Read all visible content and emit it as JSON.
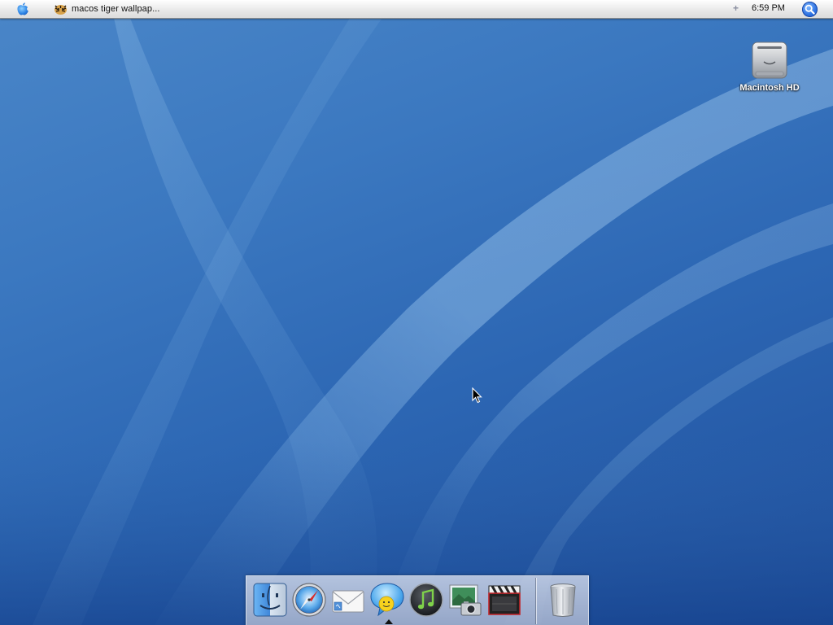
{
  "menubar": {
    "apple_icon": "apple-icon",
    "window_title": "macos tiger wallpap...",
    "app_icon": "tiger-icon",
    "menu_extra": "+",
    "clock": "6:59 PM",
    "spotlight_icon": "spotlight-search-icon"
  },
  "desktop": {
    "icons": [
      {
        "label": "Macintosh HD",
        "icon": "hard-drive-icon"
      }
    ]
  },
  "dock": {
    "items": [
      {
        "name": "finder",
        "icon": "finder-icon"
      },
      {
        "name": "safari",
        "icon": "safari-icon"
      },
      {
        "name": "mail",
        "icon": "mail-icon"
      },
      {
        "name": "ichat",
        "icon": "ichat-icon",
        "running": true
      },
      {
        "name": "itunes",
        "icon": "itunes-icon"
      },
      {
        "name": "iphoto",
        "icon": "iphoto-icon"
      },
      {
        "name": "imovie",
        "icon": "imovie-icon"
      },
      {
        "name": "trash",
        "icon": "trash-icon"
      }
    ]
  },
  "colors": {
    "wallpaper_base": "#2c66b3",
    "wallpaper_light": "#6fa8dc",
    "menubar": "#e9e9e9",
    "spotlight": "#2a6fe0"
  }
}
